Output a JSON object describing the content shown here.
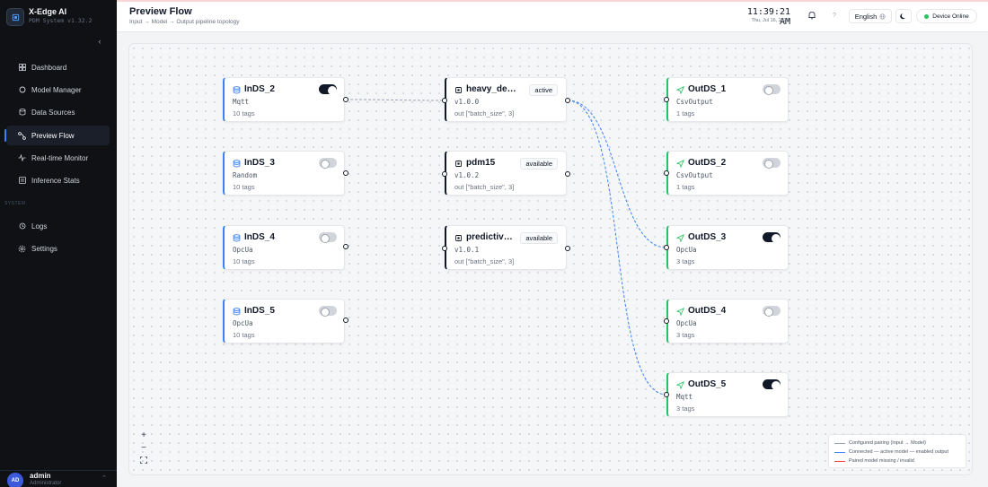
{
  "app": {
    "title": "X-Edge AI",
    "subtitle": "PDM System v1.32.2"
  },
  "sidebar": {
    "items": [
      {
        "label": "Dashboard",
        "icon": "grid-icon"
      },
      {
        "label": "Model Manager",
        "icon": "circle-icon"
      },
      {
        "label": "Data Sources",
        "icon": "database-icon"
      },
      {
        "label": "Preview Flow",
        "icon": "flow-icon",
        "active": true
      },
      {
        "label": "Real-time Monitor",
        "icon": "activity-icon"
      },
      {
        "label": "Inference Stats",
        "icon": "list-icon"
      }
    ],
    "section_label": "SYSTEM",
    "system_items": [
      {
        "label": "Logs",
        "icon": "history-icon"
      },
      {
        "label": "Settings",
        "icon": "gear-icon"
      }
    ],
    "user": {
      "initials": "AD",
      "name": "admin",
      "role": "Administrator"
    }
  },
  "header": {
    "title": "Preview Flow",
    "breadcrumb": "Input → Model → Output pipeline topology",
    "time": "11:39:21 AM",
    "date": "Thu, Jul 16, 2026",
    "language": "English",
    "status": "Device Online"
  },
  "inputs": [
    {
      "name": "InDS_2",
      "type": "Mqtt",
      "tags": "10 tags",
      "enabled": true
    },
    {
      "name": "InDS_3",
      "type": "Random",
      "tags": "10 tags",
      "enabled": false
    },
    {
      "name": "InDS_4",
      "type": "OpcUa",
      "tags": "10 tags",
      "enabled": false
    },
    {
      "name": "InDS_5",
      "type": "OpcUa",
      "tags": "10 tags",
      "enabled": false
    }
  ],
  "models": [
    {
      "name": "heavy_demo",
      "version": "v1.0.0",
      "status": "active",
      "out": "out [\"batch_size\", 3]"
    },
    {
      "name": "pdm15",
      "version": "v1.0.2",
      "status": "available",
      "out": "out [\"batch_size\", 3]"
    },
    {
      "name": "predictive_maintenance",
      "version": "v1.0.1",
      "status": "available",
      "out": "out [\"batch_size\", 3]"
    }
  ],
  "outputs": [
    {
      "name": "OutDS_1",
      "type": "CsvOutput",
      "tags": "1 tags",
      "enabled": false
    },
    {
      "name": "OutDS_2",
      "type": "CsvOutput",
      "tags": "1 tags",
      "enabled": false
    },
    {
      "name": "OutDS_3",
      "type": "OpcUa",
      "tags": "3 tags",
      "enabled": true
    },
    {
      "name": "OutDS_4",
      "type": "OpcUa",
      "tags": "3 tags",
      "enabled": false
    },
    {
      "name": "OutDS_5",
      "type": "Mqtt",
      "tags": "3 tags",
      "enabled": true
    }
  ],
  "legend": [
    {
      "label": "Configured pairing (Input → Model)",
      "color": "#9ca3af"
    },
    {
      "label": "Connected — active model — enabled output",
      "color": "#3b82f6"
    },
    {
      "label": "Paired model missing / invalid",
      "color": "#ef4444"
    }
  ],
  "colors": {
    "accent": "#3b82f6",
    "input": "#3b82f6",
    "output": "#22c55e",
    "online": "#22c55e",
    "sidebar_bg": "#0f1115"
  }
}
